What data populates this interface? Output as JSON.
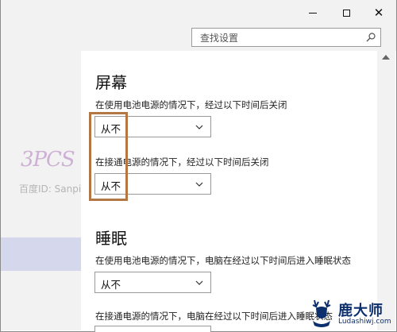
{
  "search": {
    "placeholder": "查找设置"
  },
  "watermark": {
    "logo_text": "3PCS",
    "text": "百度ID: Sanpitt"
  },
  "screen": {
    "title": "屏幕",
    "battery_label": "在使用电池电源的情况下，经过以下时间后关闭",
    "battery_value": "从不",
    "plugged_label": "在接通电源的情况下，经过以下时间后关闭",
    "plugged_value": "从不"
  },
  "sleep": {
    "title": "睡眠",
    "battery_label": "在使用电池电源的情况下，电脑在经过以下时间后进入睡眠状态",
    "battery_value": "从不",
    "plugged_label": "在接通电源的情况下，电脑在经过以下时间后进入睡眠状态"
  },
  "brand": {
    "name": "鹿大师",
    "url": "Ludashiwj.com"
  },
  "colors": {
    "highlight": "#b37746",
    "nav_selected": "#d5d8ec",
    "chrome": "#f2f2f2"
  }
}
